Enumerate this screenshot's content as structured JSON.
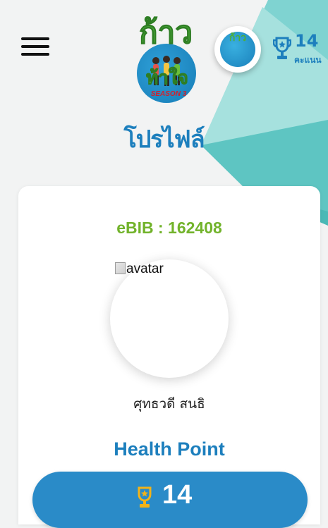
{
  "header": {
    "logo_title": "ก้าว",
    "logo_subtitle": "ท้าใจ",
    "logo_season": "SEASON 3",
    "score_value": "14",
    "score_unit": "คะแนน",
    "icons": [
      "menu-icon",
      "trophy-icon"
    ]
  },
  "page": {
    "title": "โปรไฟล์"
  },
  "profile": {
    "ebib": "eBIB : 162408",
    "avatar_alt": "avatar",
    "name": "ศุทธวดี สนธิ"
  },
  "health": {
    "title": "Health Point",
    "value": "14"
  },
  "colors": {
    "brand_blue": "#1d7fbd",
    "bar_blue": "#2a8bc8",
    "green": "#72b32b",
    "teal": "#5fc7c3",
    "gold": "#f2b318"
  }
}
